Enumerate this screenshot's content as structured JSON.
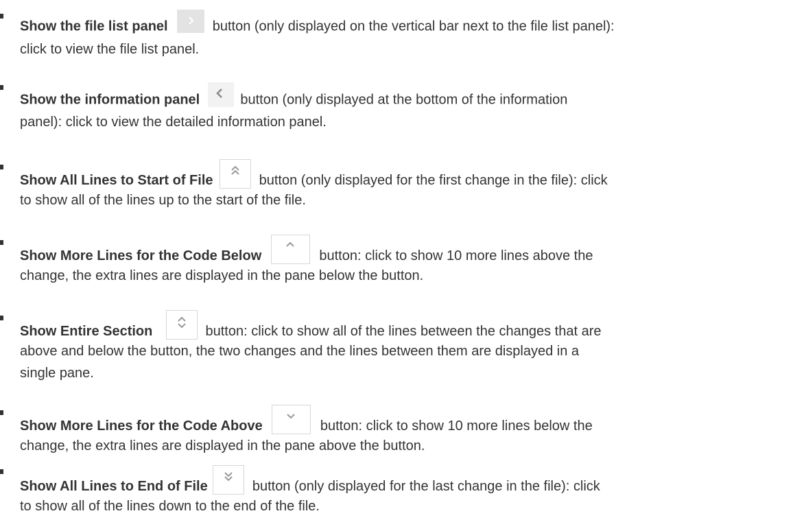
{
  "items": [
    {
      "name": "Show the file list panel",
      "icon": "chevron-right-icon",
      "after_icon": "button (only displayed on the vertical bar next to the file list panel):",
      "line2": "click to view the file list panel."
    },
    {
      "name": "Show the information panel",
      "icon": "chevron-left-icon",
      "after_icon": "button (only displayed at the bottom of the information",
      "line2": "panel): click to view the detailed information panel."
    },
    {
      "name": "Show All Lines to Start of File",
      "icon": "double-chevron-up-icon",
      "after_icon": "button (only displayed for the first change in the file): click",
      "line2": "to show all of the lines up to the start of the file."
    },
    {
      "name": "Show More Lines for the Code Below",
      "icon": "chevron-up-icon",
      "after_icon": "button: click to show 10 more lines above the",
      "line2": "change, the extra lines are displayed in the pane below the button."
    },
    {
      "name": "Show Entire Section",
      "icon": "expand-section-icon",
      "after_icon": "button: click to show all of the lines between the changes that are",
      "line2": "above and below the button, the two changes and the lines between them are displayed in a",
      "line3": "single pane."
    },
    {
      "name": "Show More Lines for the Code Above",
      "icon": "chevron-down-icon",
      "after_icon": "button: click to show 10 more lines below the",
      "line2": "change, the extra lines are displayed in the pane above the button."
    },
    {
      "name": "Show All Lines to End of File",
      "icon": "double-chevron-down-icon",
      "after_icon": "button (only displayed for the last change in the file): click",
      "line2": "to show all of the lines down to the end of the file."
    }
  ]
}
